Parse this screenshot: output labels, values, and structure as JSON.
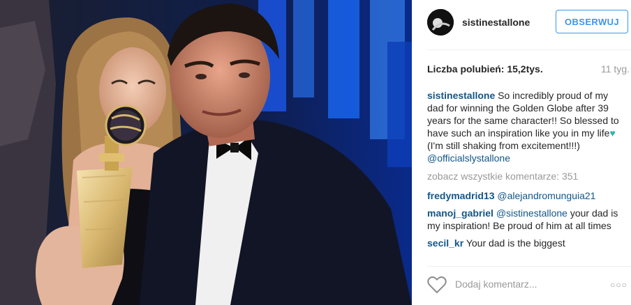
{
  "post": {
    "username": "sistinestallone",
    "follow_label": "OBSERWUJ",
    "likes_label": "Liczba polubień: 15,2tys.",
    "time_ago": "11 tyg.",
    "caption": {
      "user": "sistinestallone",
      "text": "So incredibly proud of my dad for winning the Golden Globe after 39 years for the same character!! So blessed to have such an inspiration like you in my life",
      "emoji": "♥",
      "text_after": "(I'm still shaking from excitement!!!)",
      "mention": "@officialslystallone"
    },
    "view_all_label": "zobacz wszystkie komentarze: 351",
    "comments": [
      {
        "user": "fredymadrid13",
        "mention": "@alejandromunguia21",
        "text": ""
      },
      {
        "user": "manoj_gabriel",
        "mention": "@sistinestallone",
        "text": "your dad is my inspiration! Be proud of him at all times"
      },
      {
        "user": "secil_kr",
        "mention": "",
        "text": "Your dad is the biggest"
      }
    ],
    "add_comment_placeholder": "Dodaj komentarz...",
    "more_label": "○○○",
    "icons": {
      "like": "heart-outline-icon",
      "more": "more-dots-icon"
    },
    "colors": {
      "link": "#125688",
      "follow": "#3897f0",
      "muted": "#999999"
    }
  }
}
